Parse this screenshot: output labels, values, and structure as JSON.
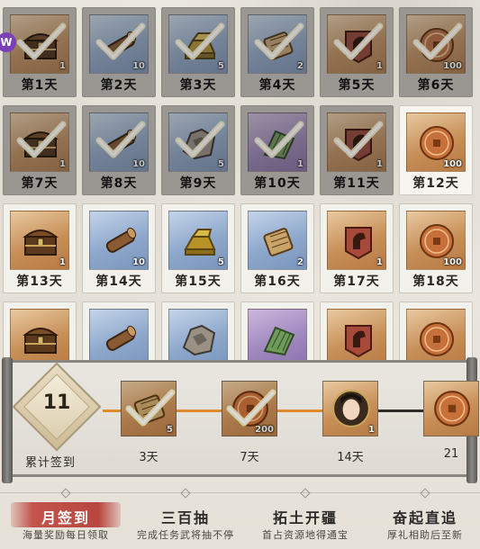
{
  "grid": {
    "days": [
      {
        "label": "第1天",
        "qty": "1",
        "icon": "treasure-chest-icon",
        "frame": "gold",
        "claimed": true
      },
      {
        "label": "第2天",
        "qty": "10",
        "icon": "wood-log-icon",
        "frame": "blue",
        "claimed": true
      },
      {
        "label": "第3天",
        "qty": "5",
        "icon": "gold-ingot-icon",
        "frame": "blue",
        "claimed": true
      },
      {
        "label": "第4天",
        "qty": "2",
        "icon": "bamboo-scroll-icon",
        "frame": "blue",
        "claimed": true
      },
      {
        "label": "第5天",
        "qty": "1",
        "icon": "horse-banner-icon",
        "frame": "gold",
        "claimed": true
      },
      {
        "label": "第6天",
        "qty": "100",
        "icon": "copper-coin-icon",
        "frame": "gold",
        "claimed": true
      },
      {
        "label": "第7天",
        "qty": "1",
        "icon": "treasure-chest-icon",
        "frame": "gold",
        "claimed": true
      },
      {
        "label": "第8天",
        "qty": "10",
        "icon": "wood-log-icon",
        "frame": "blue",
        "claimed": true
      },
      {
        "label": "第9天",
        "qty": "5",
        "icon": "iron-ore-icon",
        "frame": "blue",
        "claimed": true
      },
      {
        "label": "第10天",
        "qty": "1",
        "icon": "bamboo-slips-icon",
        "frame": "purple",
        "claimed": true
      },
      {
        "label": "第11天",
        "qty": "1",
        "icon": "horse-banner-icon",
        "frame": "gold",
        "claimed": true
      },
      {
        "label": "第12天",
        "qty": "100",
        "icon": "copper-coin-icon",
        "frame": "gold",
        "claimed": false
      },
      {
        "label": "第13天",
        "qty": "1",
        "icon": "treasure-chest-icon",
        "frame": "gold",
        "claimed": false
      },
      {
        "label": "第14天",
        "qty": "10",
        "icon": "wood-log-icon",
        "frame": "blue",
        "claimed": false
      },
      {
        "label": "第15天",
        "qty": "5",
        "icon": "gold-ingot-icon",
        "frame": "blue",
        "claimed": false
      },
      {
        "label": "第16天",
        "qty": "2",
        "icon": "bamboo-scroll-icon",
        "frame": "blue",
        "claimed": false
      },
      {
        "label": "第17天",
        "qty": "1",
        "icon": "horse-banner-icon",
        "frame": "gold",
        "claimed": false
      },
      {
        "label": "第18天",
        "qty": "100",
        "icon": "copper-coin-icon",
        "frame": "gold",
        "claimed": false
      },
      {
        "label": "",
        "qty": "",
        "icon": "treasure-chest-icon",
        "frame": "gold",
        "claimed": false
      },
      {
        "label": "",
        "qty": "",
        "icon": "wood-log-icon",
        "frame": "blue",
        "claimed": false
      },
      {
        "label": "",
        "qty": "",
        "icon": "iron-ore-icon",
        "frame": "blue",
        "claimed": false
      },
      {
        "label": "",
        "qty": "",
        "icon": "bamboo-slips-icon",
        "frame": "purple",
        "claimed": false
      },
      {
        "label": "",
        "qty": "",
        "icon": "horse-banner-icon",
        "frame": "gold",
        "claimed": false
      },
      {
        "label": "",
        "qty": "",
        "icon": "copper-coin-icon",
        "frame": "gold",
        "claimed": false
      }
    ],
    "badge": "W"
  },
  "progress": {
    "count": "11",
    "label": "累计签到",
    "milestones": [
      {
        "label": "3天",
        "qty": "5",
        "icon": "bamboo-scroll-icon",
        "frame": "gold",
        "claimed": true
      },
      {
        "label": "7天",
        "qty": "200",
        "icon": "copper-coin-icon",
        "frame": "gold",
        "claimed": true
      },
      {
        "label": "14天",
        "qty": "1",
        "icon": "portrait-avatar-icon",
        "frame": "gold",
        "claimed": false
      },
      {
        "label": "21",
        "qty": "",
        "icon": "copper-coin-icon",
        "frame": "gold",
        "claimed": false
      }
    ]
  },
  "tabs": [
    {
      "title": "月签到",
      "subtitle": "海量奖励每日领取",
      "active": true
    },
    {
      "title": "三百抽",
      "subtitle": "完成任务武将抽不停",
      "active": false
    },
    {
      "title": "拓土开疆",
      "subtitle": "首占资源地得通宝",
      "active": false
    },
    {
      "title": "奋起直追",
      "subtitle": "厚礼相助后至新",
      "active": false
    }
  ],
  "colors": {
    "accent": "#c2544b",
    "progress": "#e08a2e",
    "check": "#fff6c8"
  }
}
